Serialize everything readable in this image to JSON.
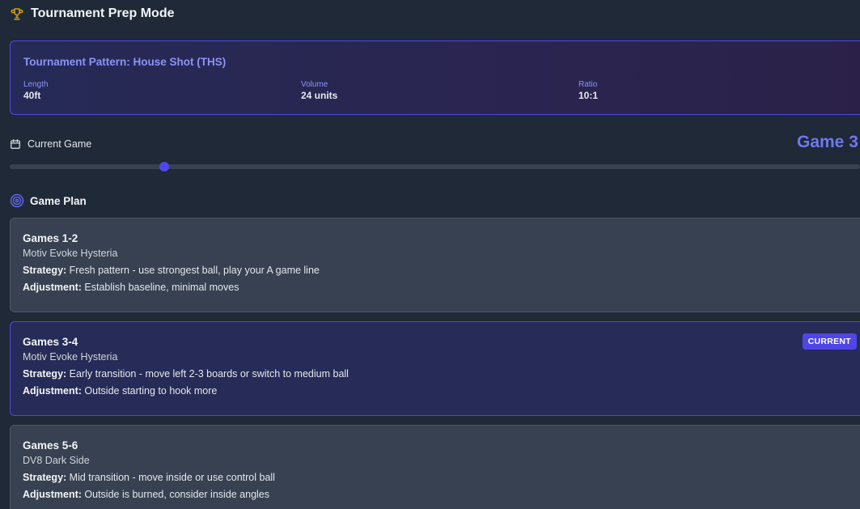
{
  "header": {
    "title": "Tournament Prep Mode",
    "icon": "trophy-icon"
  },
  "pattern": {
    "title": "Tournament Pattern: House Shot (THS)",
    "stats": [
      {
        "label": "Length",
        "value": "40ft"
      },
      {
        "label": "Volume",
        "value": "24 units"
      },
      {
        "label": "Ratio",
        "value": "10:1"
      }
    ]
  },
  "current_game": {
    "label": "Current Game",
    "display": "Game 3",
    "value": 3,
    "min": 1,
    "max": 12
  },
  "plan": {
    "title": "Game Plan",
    "strategy_label": "Strategy:",
    "adjustment_label": "Adjustment:",
    "cards": [
      {
        "title": "Games 1-2",
        "ball": "Motiv Evoke Hysteria",
        "strategy": "Fresh pattern - use strongest ball, play your A game line",
        "adjustment": "Establish baseline, minimal moves",
        "current": false
      },
      {
        "title": "Games 3-4",
        "ball": "Motiv Evoke Hysteria",
        "strategy": "Early transition - move left 2-3 boards or switch to medium ball",
        "adjustment": "Outside starting to hook more",
        "current": true,
        "badge": "CURRENT"
      },
      {
        "title": "Games 5-6",
        "ball": "DV8 Dark Side",
        "strategy": "Mid transition - move inside or use control ball",
        "adjustment": "Outside is burned, consider inside angles",
        "current": false
      }
    ]
  },
  "colors": {
    "accent": "#4f46e5",
    "accent_text": "#6f77f0",
    "trophy": "#d4a017"
  }
}
